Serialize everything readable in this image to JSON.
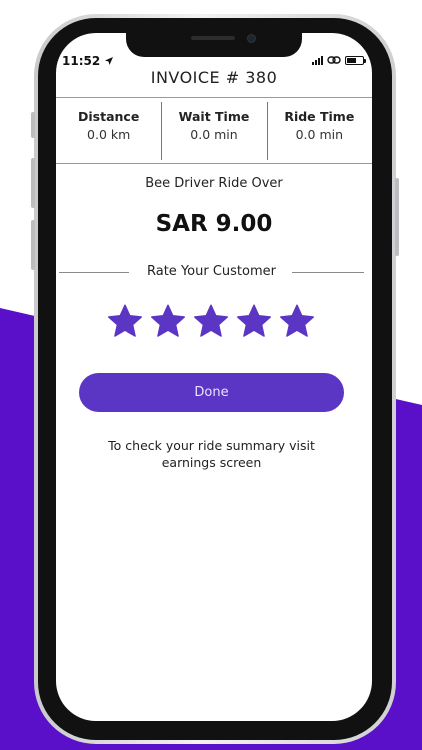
{
  "status_bar": {
    "time": "11:52",
    "location_icon": "navigation-arrow-icon",
    "signal_icon": "cellular-signal-icon",
    "link_icon": "link-icon",
    "battery_icon": "battery-icon"
  },
  "invoice": {
    "title": "INVOICE # 380"
  },
  "metrics": [
    {
      "label": "Distance",
      "value": "0.0 km"
    },
    {
      "label": "Wait Time",
      "value": "0.0 min"
    },
    {
      "label": "Ride Time",
      "value": "0.0 min"
    }
  ],
  "ride": {
    "status_text": "Bee Driver Ride Over",
    "amount": "SAR 9.00"
  },
  "rating": {
    "label": "Rate Your Customer",
    "stars": 5,
    "max_stars": 5,
    "star_color": "#5b35c4"
  },
  "actions": {
    "done_label": "Done"
  },
  "footer": {
    "note": "To check your ride summary visit earnings screen"
  },
  "colors": {
    "accent": "#5b35c4",
    "background_band": "#5a0fc8"
  }
}
